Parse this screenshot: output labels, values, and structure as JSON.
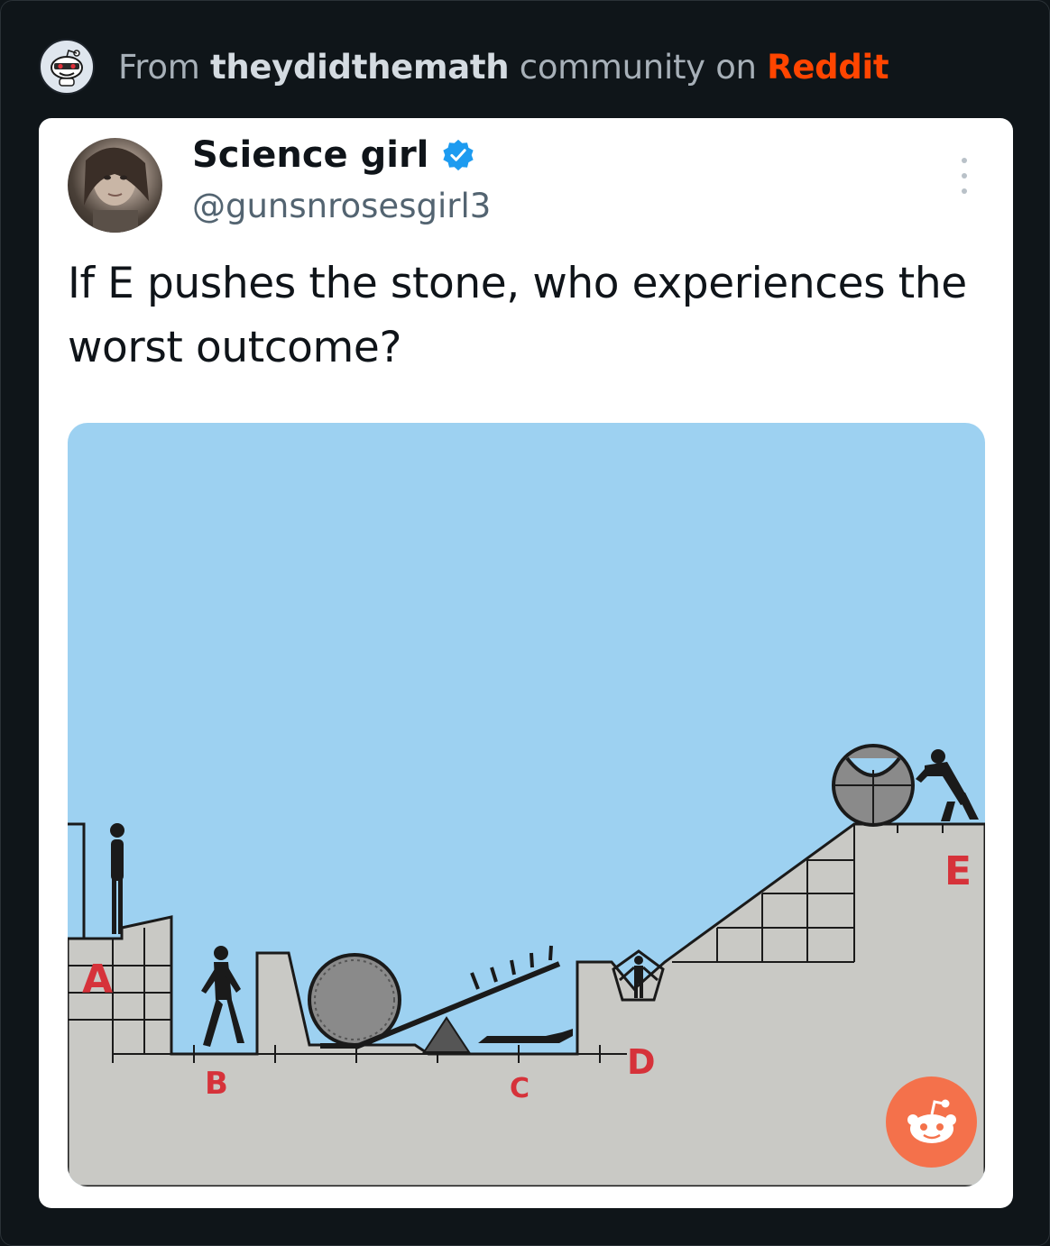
{
  "header": {
    "prefix": "From",
    "community": "theydidthemath",
    "middle": "community on",
    "platform": "Reddit"
  },
  "tweet": {
    "author_name": "Science girl",
    "author_handle": "@gunsnrosesgirl3",
    "verified": true,
    "text": "If E pushes the stone, who experiences the worst outcome?"
  },
  "puzzle": {
    "labels": [
      "A",
      "B",
      "C",
      "D",
      "E"
    ]
  },
  "colors": {
    "background": "#0f1519",
    "reddit_orange": "#ff4500",
    "verified_blue": "#1d9bf0",
    "sky": "#9dd1f1",
    "ground": "#c9c9c5",
    "label_red": "#d6323a"
  },
  "icons": {
    "subreddit": "snoo-avatar-icon",
    "verified": "verified-badge-icon",
    "more": "more-options-icon",
    "share": "reddit-snoo-icon"
  }
}
